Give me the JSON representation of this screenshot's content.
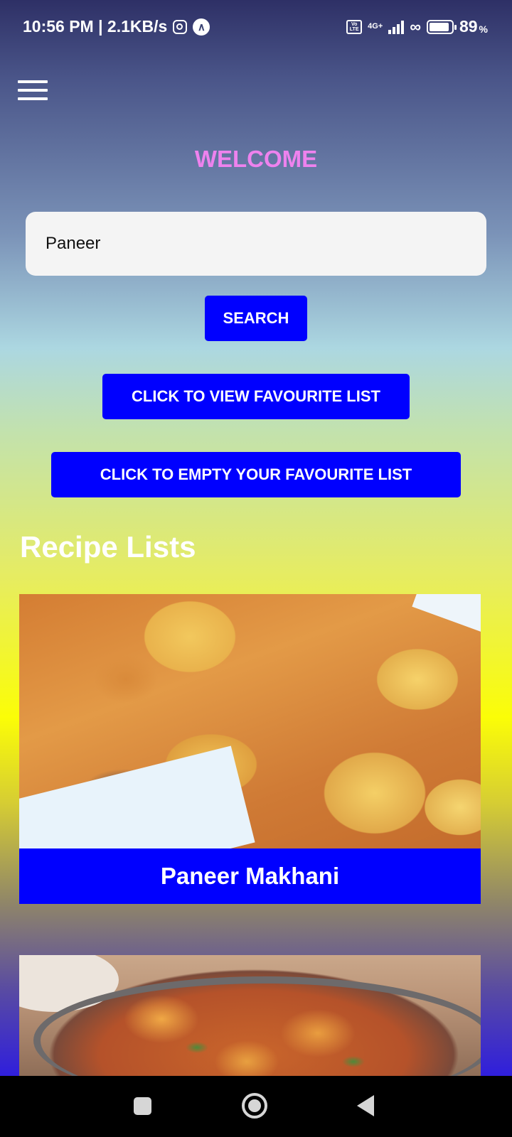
{
  "status_bar": {
    "time_speed": "10:56 PM | 2.1KB/s",
    "network_type": "4G+",
    "battery_percent": "89",
    "battery_unit": "%",
    "icons": [
      "instagram-icon",
      "a-app-icon",
      "volte-icon",
      "signal-icon",
      "link-icon",
      "battery-icon"
    ]
  },
  "header": {
    "menu_icon": "hamburger-menu-icon",
    "welcome_text": "WELCOME"
  },
  "search": {
    "value": "Paneer",
    "button_label": "SEARCH"
  },
  "actions": {
    "view_favourites_label": "CLICK TO VIEW FAVOURITE LIST",
    "empty_favourites_label": "CLICK TO EMPTY YOUR FAVOURITE LIST"
  },
  "recipes": {
    "section_title": "Recipe Lists",
    "items": [
      {
        "name": "Paneer Makhani"
      },
      {
        "name": ""
      }
    ]
  },
  "colors": {
    "button_blue": "#0000ff",
    "welcome_pink": "#ee82ee",
    "search_bg": "#f4f4f4"
  },
  "nav_bar": {
    "icons": [
      "recent-apps-icon",
      "home-icon",
      "back-icon"
    ]
  }
}
